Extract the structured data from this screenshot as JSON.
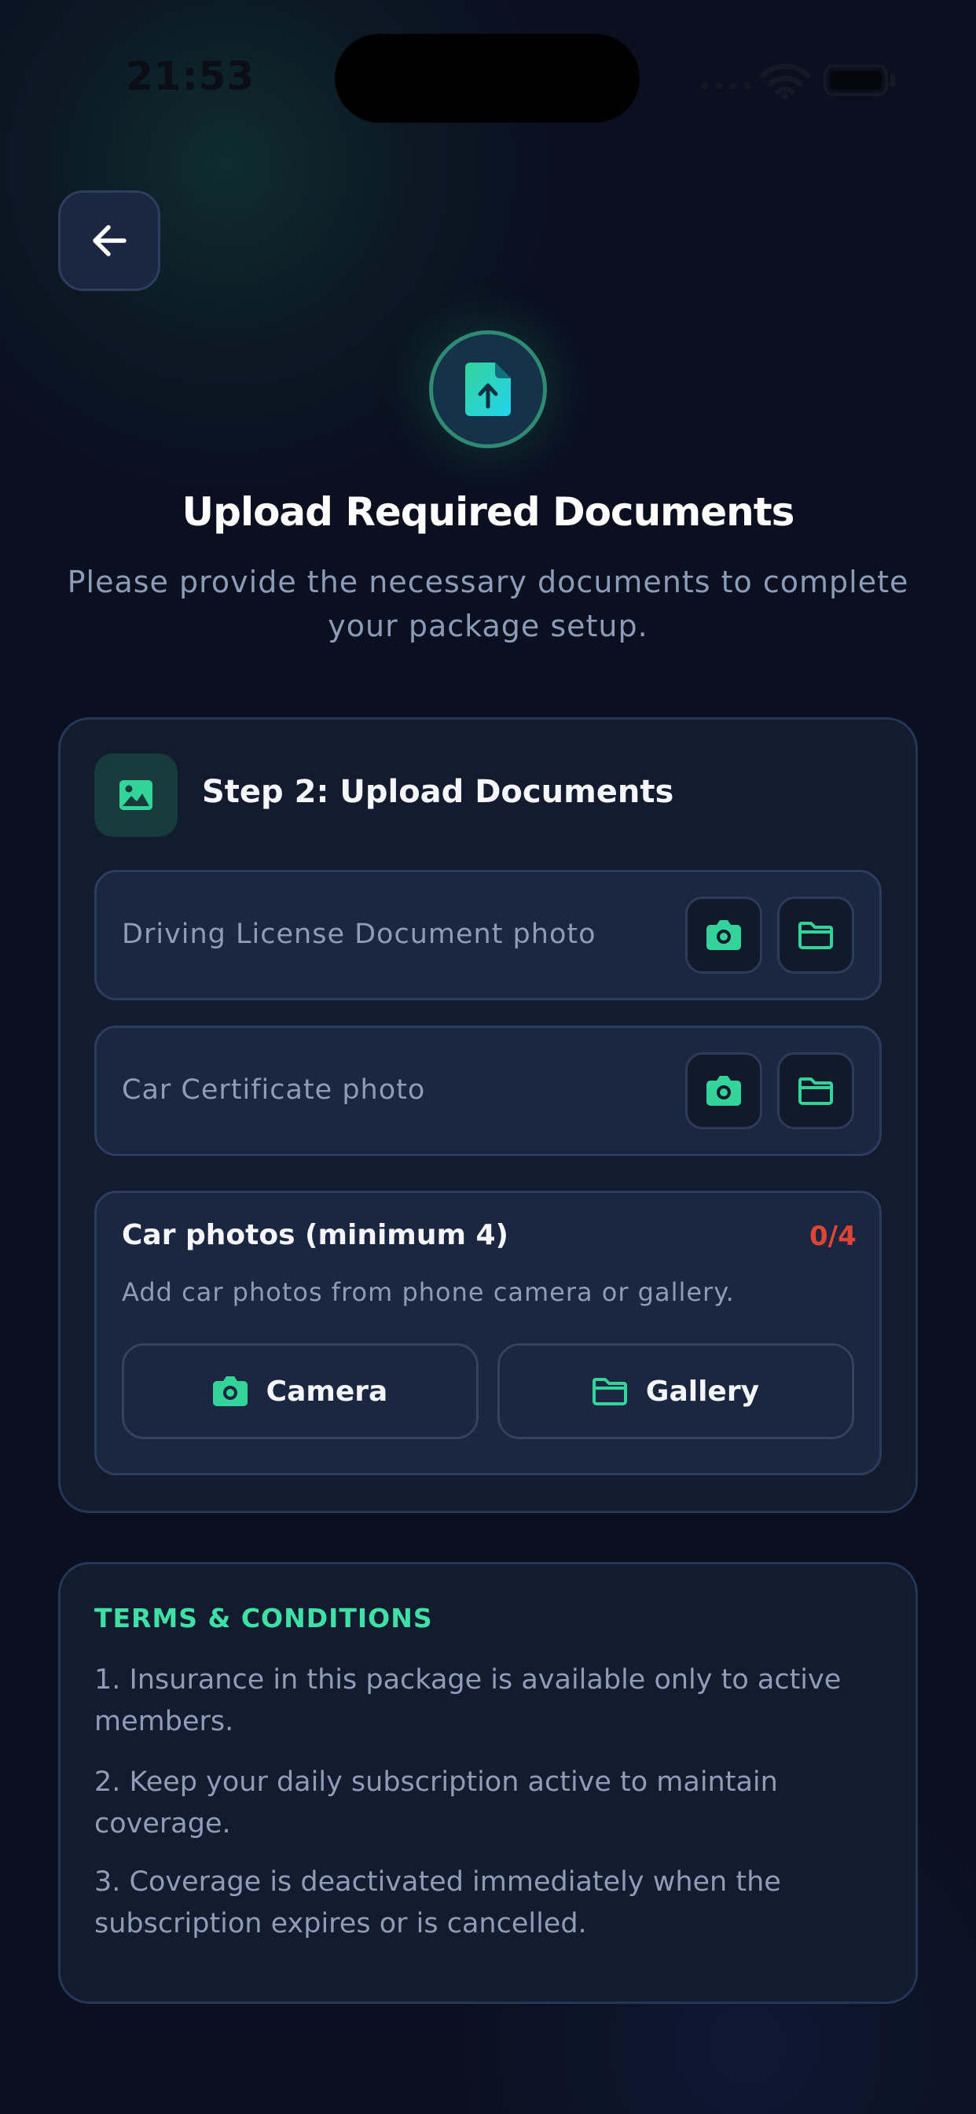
{
  "status_bar": {
    "time": "21:53"
  },
  "header": {
    "title": "Upload Required Documents",
    "subtitle": "Please provide the necessary documents to complete your package setup."
  },
  "step": {
    "title": "Step 2: Upload Documents",
    "documents": [
      {
        "label": "Driving License Document photo"
      },
      {
        "label": "Car Certificate photo"
      }
    ],
    "car_photos": {
      "title": "Car photos (minimum 4)",
      "count": "0/4",
      "description": "Add car photos from phone camera or gallery.",
      "camera_label": "Camera",
      "gallery_label": "Gallery"
    }
  },
  "terms": {
    "title": "TERMS & CONDITIONS",
    "items": [
      "1. Insurance in this package is available only to active members.",
      "2. Keep your daily subscription active to maintain coverage.",
      "3. Coverage is deactivated immediately when the subscription expires or is cancelled."
    ]
  },
  "colors": {
    "accent": "#34d399",
    "accent_cyan": "#22d3ee",
    "count_red": "#e04435",
    "background": "#0a1020"
  }
}
